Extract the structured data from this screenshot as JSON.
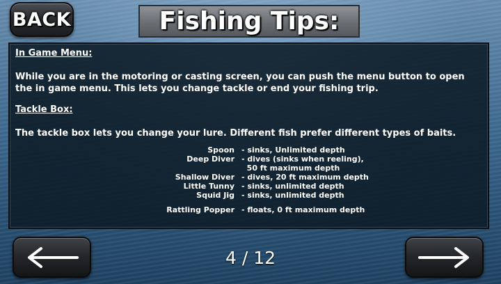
{
  "header": {
    "back_label": "BACK",
    "title": "Fishing Tips:"
  },
  "panel": {
    "section1_heading": "In Game Menu:",
    "section1_text": "While you are in the motoring or casting screen, you can push the menu button to open the in game menu.  This lets you change tackle or end your fishing trip.",
    "section2_heading": "Tackle Box:",
    "section2_text": "The tackle box lets you change your lure.  Different fish prefer different types of baits.",
    "lures": [
      {
        "name": "Spoon",
        "desc": "- sinks, Unlimited depth"
      },
      {
        "name": "Deep Diver",
        "desc": "- dives (sinks when reeling),\n  50 ft maximum depth"
      },
      {
        "name": "Shallow Diver",
        "desc": "- dives, 20 ft maximum depth"
      },
      {
        "name": "Little Tunny",
        "desc": "- sinks, unlimited depth"
      },
      {
        "name": "Squid Jig",
        "desc": "- sinks, unlimited depth"
      },
      {
        "name": "Rattling Popper",
        "desc": "- floats, 0 ft maximum depth"
      }
    ]
  },
  "footer": {
    "page_counter": "4 / 12",
    "prev_icon": "left-arrow-icon",
    "next_icon": "right-arrow-icon"
  },
  "colors": {
    "panel_bg": "#0c1a26",
    "text": "#ffffff"
  }
}
